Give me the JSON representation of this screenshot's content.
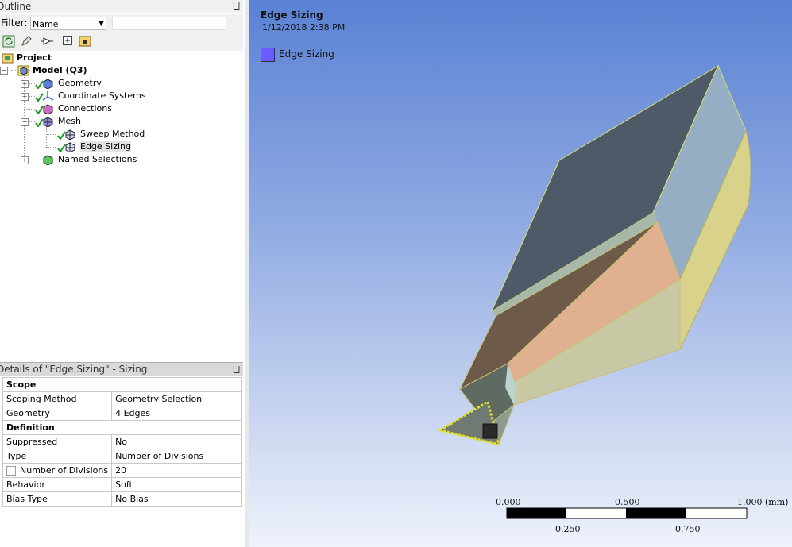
{
  "outline": {
    "title": "Outline",
    "filter_label": "Filter:",
    "filter_value": "Name",
    "filter_text": ""
  },
  "tree": {
    "project": "Project",
    "model": "Model (Q3)",
    "geometry": "Geometry",
    "coordinate_systems": "Coordinate Systems",
    "connections": "Connections",
    "mesh": "Mesh",
    "sweep_method": "Sweep Method",
    "edge_sizing": "Edge Sizing",
    "named_selections": "Named Selections"
  },
  "details": {
    "title": "Details of \"Edge Sizing\" - Sizing",
    "rows": {
      "scope": "Scope",
      "scoping_method_label": "Scoping Method",
      "scoping_method_value": "Geometry Selection",
      "geometry_label": "Geometry",
      "geometry_value": "4 Edges",
      "definition": "Definition",
      "suppressed_label": "Suppressed",
      "suppressed_value": "No",
      "type_label": "Type",
      "type_value": "Number of Divisions",
      "num_div_label": "Number of Divisions",
      "num_div_value": "20",
      "behavior_label": "Behavior",
      "behavior_value": "Soft",
      "bias_label": "Bias Type",
      "bias_value": "No Bias"
    }
  },
  "viewport": {
    "title": "Edge Sizing",
    "date": "1/12/2018 2:38 PM",
    "legend": {
      "label": "Edge Sizing",
      "color": "#6a5cff"
    },
    "scale": {
      "t0": "0.000",
      "t1": "0.500",
      "t2": "1.000 (mm)",
      "b1": "0.250",
      "b2": "0.750"
    }
  }
}
